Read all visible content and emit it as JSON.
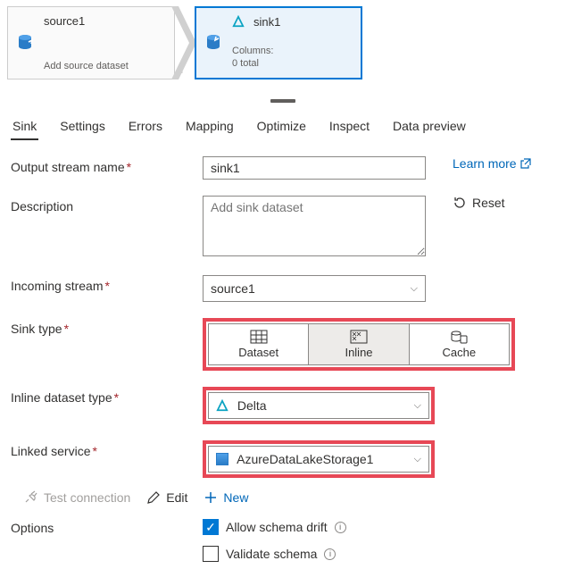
{
  "flow": {
    "source": {
      "title": "source1",
      "subtitle": "Add source dataset"
    },
    "sink": {
      "title": "sink1",
      "cols_label": "Columns:",
      "cols_value": "0 total"
    },
    "plus": "+"
  },
  "tabs": [
    "Sink",
    "Settings",
    "Errors",
    "Mapping",
    "Optimize",
    "Inspect",
    "Data preview"
  ],
  "active_tab": 0,
  "form": {
    "output_stream": {
      "label": "Output stream name",
      "value": "sink1"
    },
    "description": {
      "label": "Description",
      "placeholder": "Add sink dataset"
    },
    "incoming": {
      "label": "Incoming stream",
      "value": "source1"
    },
    "sink_type": {
      "label": "Sink type",
      "options": [
        "Dataset",
        "Inline",
        "Cache"
      ],
      "selected": 1
    },
    "inline_type": {
      "label": "Inline dataset type",
      "value": "Delta"
    },
    "linked_service": {
      "label": "Linked service",
      "value": "AzureDataLakeStorage1"
    },
    "learn_more": "Learn more",
    "reset": "Reset",
    "options_label": "Options",
    "allow_drift": "Allow schema drift",
    "validate_schema": "Validate schema"
  },
  "actions": {
    "test": "Test connection",
    "edit": "Edit",
    "new": "New"
  }
}
